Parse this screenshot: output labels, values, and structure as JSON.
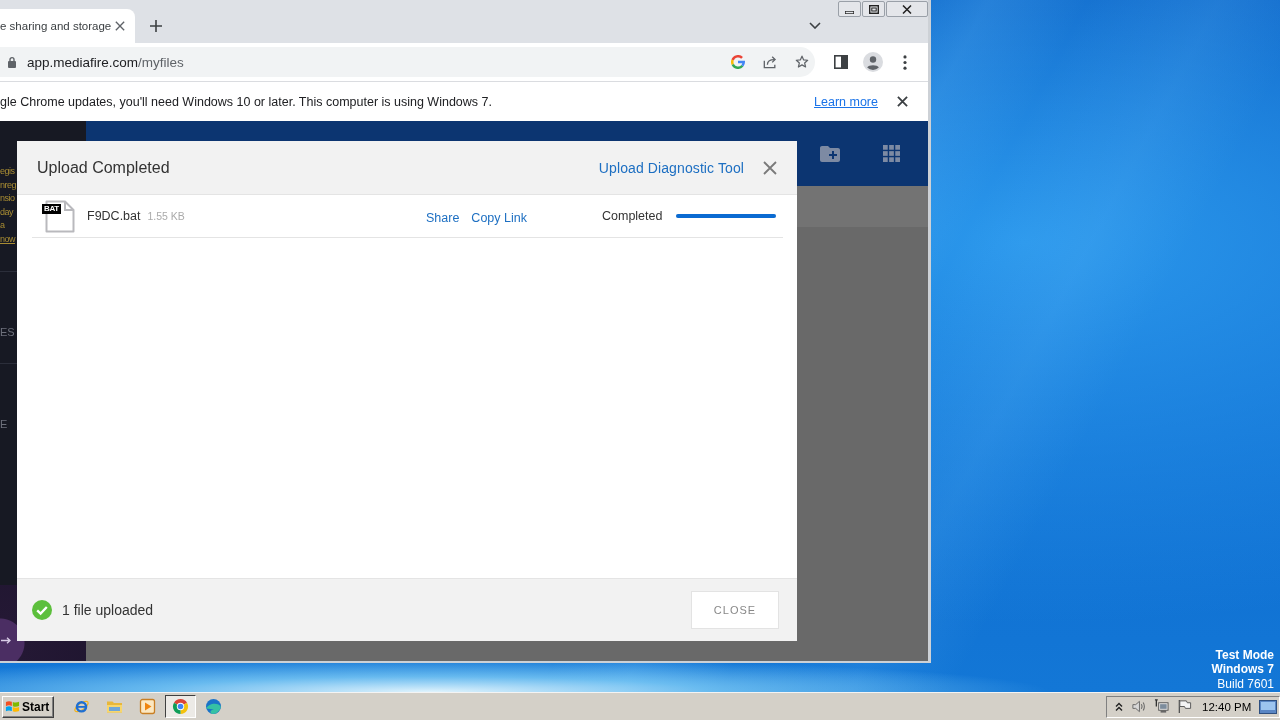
{
  "browser": {
    "tabs": [
      {
        "title": "e sharing and storage",
        "selected": true
      }
    ],
    "address_bar": {
      "host": "app.mediafire.com",
      "path": "/myfiles"
    },
    "infobar": {
      "message": "gle Chrome updates, you'll need Windows 10 or later. This computer is using Windows 7.",
      "link": "Learn more"
    }
  },
  "page": {
    "sidebar": {
      "promo_lines": [
        "egis",
        "nreg",
        "nsio",
        "day",
        "a"
      ],
      "promo_link": "now",
      "section_labels": [
        "ES",
        "E"
      ]
    }
  },
  "upload_dialog": {
    "title": "Upload Completed",
    "diagnostic_link": "Upload Diagnostic Tool",
    "files": [
      {
        "type_badge": "BAT",
        "name": "F9DC.bat",
        "size": "1.55 KB",
        "actions": [
          "Share",
          "Copy Link"
        ],
        "status": "Completed",
        "level": 1
      }
    ],
    "summary": "1 file uploaded",
    "close_button": "CLOSE"
  },
  "desktop": {
    "notice_lines": [
      "Test Mode",
      "Windows 7",
      "Build 7601"
    ]
  },
  "taskbar": {
    "start_label": "Start",
    "apps": [
      {
        "kind": "ie",
        "selected": false
      },
      {
        "kind": "explorer",
        "selected": false
      },
      {
        "kind": "media",
        "selected": false
      },
      {
        "kind": "chrome",
        "selected": true
      },
      {
        "kind": "edge",
        "selected": false
      }
    ],
    "clock": "12:40 PM"
  }
}
